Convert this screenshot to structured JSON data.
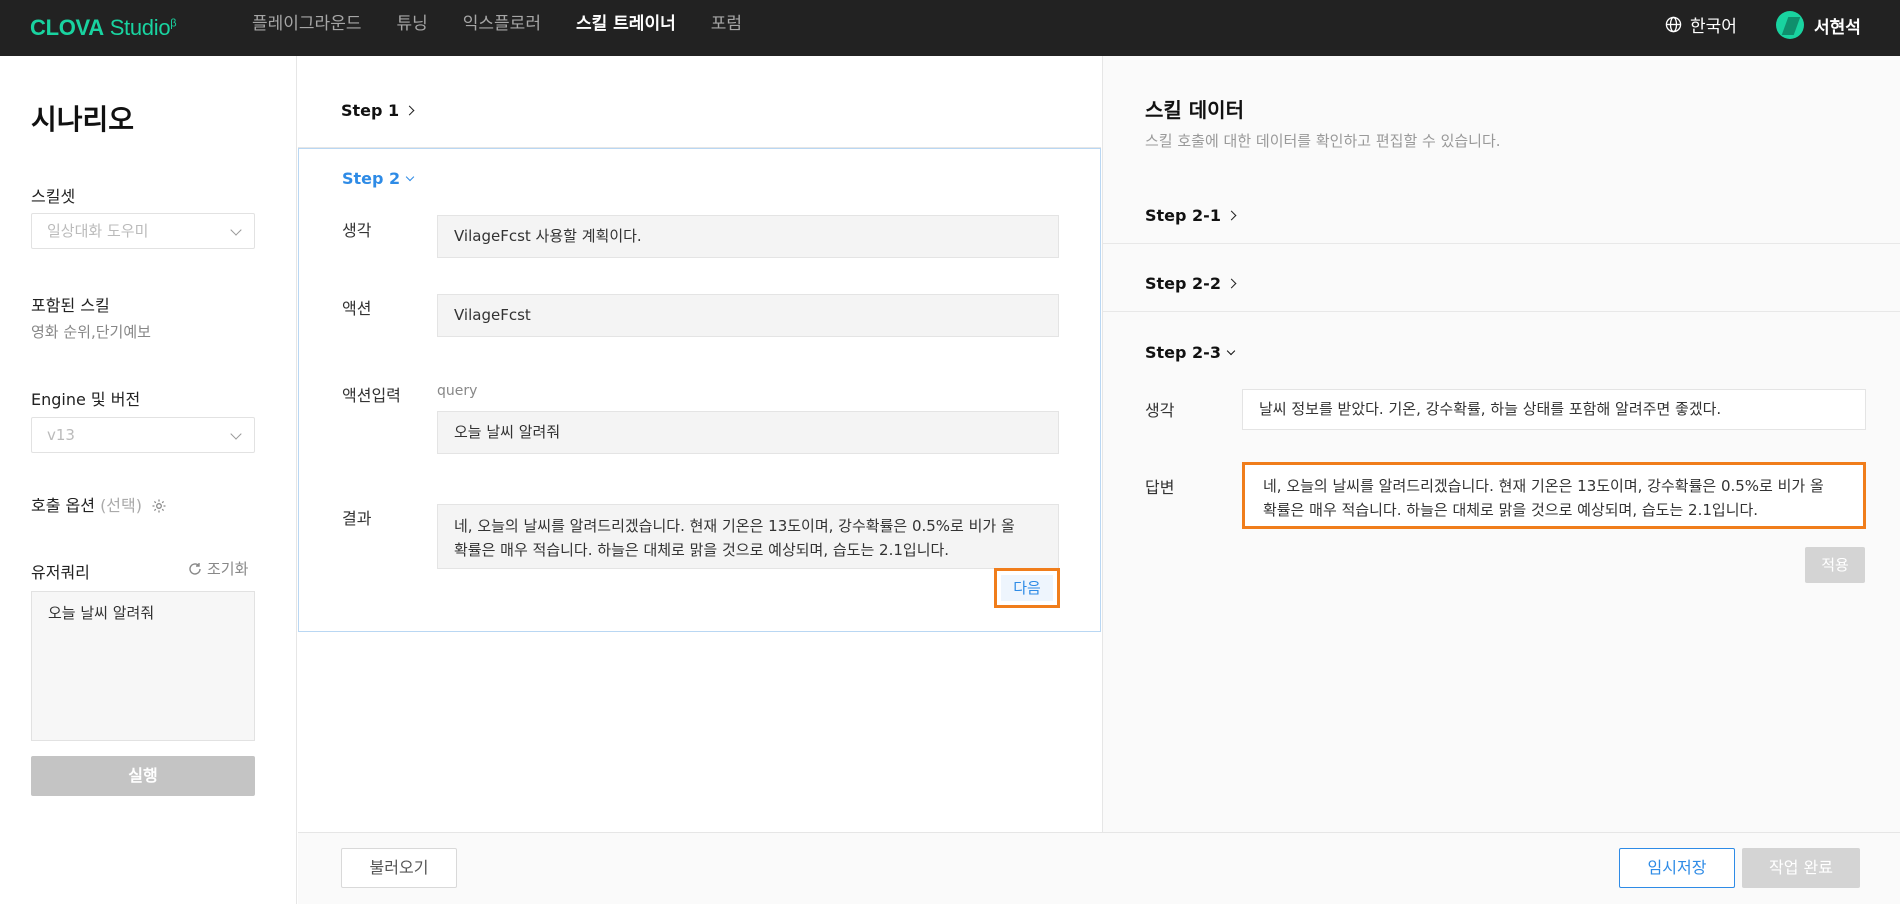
{
  "header": {
    "logo_brand": "CLOVA",
    "logo_product": "Studio",
    "logo_badge": "β",
    "nav": [
      "플레이그라운드",
      "튜닝",
      "익스플로러",
      "스킬 트레이너",
      "포럼"
    ],
    "active_nav": "스킬 트레이너",
    "language": "한국어",
    "user_name": "서현석"
  },
  "sidebar": {
    "title": "시나리오",
    "skillset_label": "스킬셋",
    "skillset_value": "일상대화 도우미",
    "included_skills_label": "포함된 스킬",
    "included_skills_value": "영화 순위,단기예보",
    "engine_label": "Engine 및 버전",
    "engine_value": "v13",
    "call_options_label": "호출 옵션",
    "call_options_optional": "(선택)",
    "user_query_label": "유저쿼리",
    "reset_label": "조기화",
    "user_query_value": "오늘 날씨 알려줘",
    "run_button": "실행"
  },
  "middle": {
    "step1_title": "Step 1",
    "step2_title": "Step 2",
    "thought_label": "생각",
    "thought_value": "VilageFcst 사용할 계획이다.",
    "action_label": "액션",
    "action_value": "VilageFcst",
    "action_input_label": "액션입력",
    "action_input_hint": "query",
    "action_input_value": "오늘 날씨 알려줘",
    "result_label": "결과",
    "result_value_line1": "네, 오늘의 날씨를 알려드리겠습니다. 현재 기온은 13도이며, 강수확률은 0.5%로 비가 올",
    "result_value_line2": "확률은 매우 적습니다. 하늘은 대체로 맑을 것으로 예상되며, 습도는 2.1입니다.",
    "next_button": "다음"
  },
  "right": {
    "title": "스킬 데이터",
    "subtitle": "스킬 호출에 대한 데이터를 확인하고 편집할 수 있습니다.",
    "step_2_1": "Step 2-1",
    "step_2_2": "Step 2-2",
    "step_2_3": "Step 2-3",
    "thought_label": "생각",
    "thought_value": "날씨 정보를 받았다. 기온, 강수확률, 하늘 상태를 포함해 알려주면 좋겠다.",
    "answer_label": "답변",
    "answer_value_line1": "네, 오늘의 날씨를 알려드리겠습니다. 현재 기온은 13도이며, 강수확률은 0.5%로 비가 올",
    "answer_value_line2": "확률은 매우 적습니다. 하늘은 대체로 맑을 것으로 예상되며, 습도는 2.1입니다.",
    "apply_button": "적용"
  },
  "footer": {
    "load_button": "불러오기",
    "temp_save_button": "임시저장",
    "complete_button": "작업 완료"
  },
  "colors": {
    "topbar_bg": "#222222",
    "brand_green": "#19d3a0",
    "accent_blue": "#2e8be6",
    "highlight_orange": "#f07d1b",
    "disabled_gray": "#c4c4c4"
  }
}
